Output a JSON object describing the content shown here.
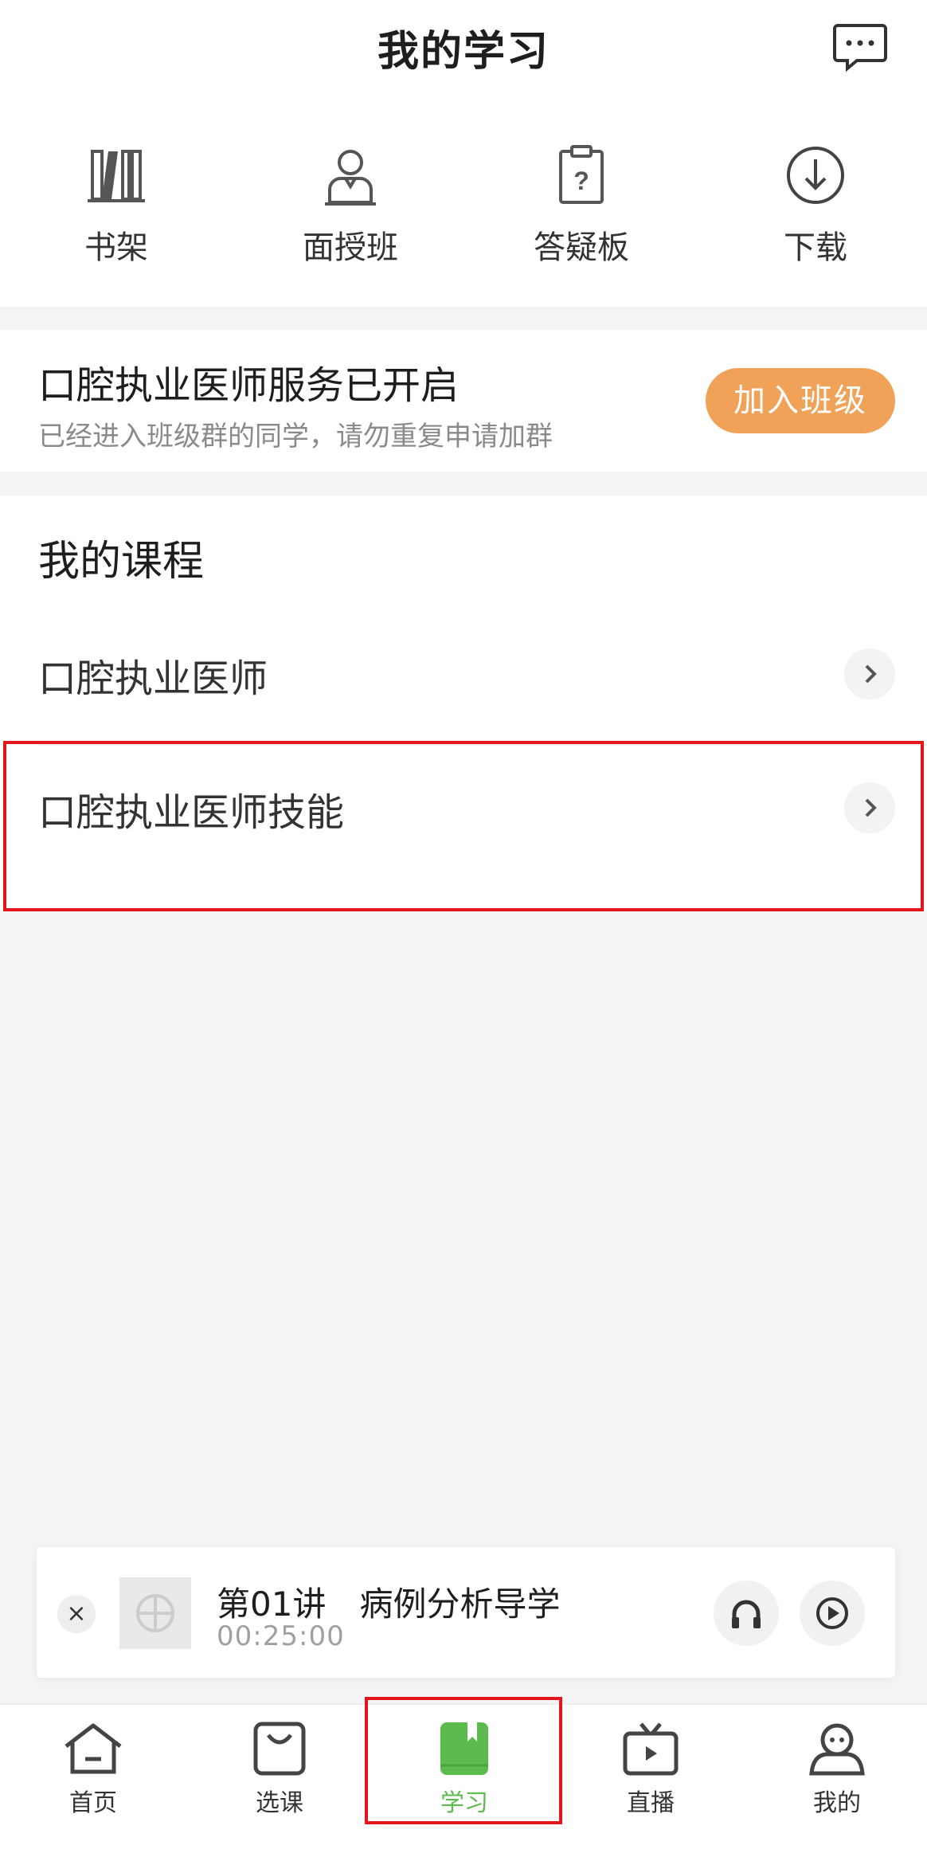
{
  "header": {
    "title": "我的学习"
  },
  "shortcuts": [
    {
      "label": "书架",
      "icon": "bookshelf-icon"
    },
    {
      "label": "面授班",
      "icon": "teacher-icon"
    },
    {
      "label": "答疑板",
      "icon": "question-board-icon"
    },
    {
      "label": "下载",
      "icon": "download-icon"
    }
  ],
  "service": {
    "title": "口腔执业医师服务已开启",
    "subtitle": "已经进入班级群的同学，请勿重复申请加群",
    "join_label": "加入班级"
  },
  "courses": {
    "title": "我的课程",
    "items": [
      {
        "name": "口腔执业医师"
      },
      {
        "name": "口腔执业医师技能"
      }
    ]
  },
  "player": {
    "close": "×",
    "episode": "第01讲　病例分析导学",
    "time": "00:25:00"
  },
  "tabbar": {
    "items": [
      {
        "label": "首页"
      },
      {
        "label": "选课"
      },
      {
        "label": "学习"
      },
      {
        "label": "直播"
      },
      {
        "label": "我的"
      }
    ],
    "active_index": 2,
    "active_color": "#5cbb4d"
  },
  "colors": {
    "accent_orange": "#f0a258",
    "highlight_red": "#e3161b",
    "active_green": "#5cbb4d"
  }
}
